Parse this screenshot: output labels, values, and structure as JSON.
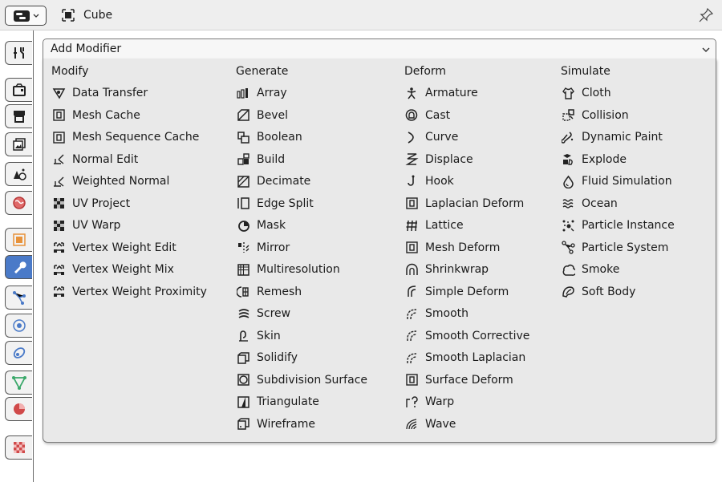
{
  "header": {
    "object_name": "Cube",
    "editor_icon": "properties-editor-icon",
    "pin_icon": "pin-icon"
  },
  "add_modifier": {
    "label": "Add Modifier",
    "chevron": "chevron-down-icon"
  },
  "columns": [
    {
      "title": "Modify",
      "items": [
        {
          "label": "Data Transfer",
          "icon": "data-transfer-icon"
        },
        {
          "label": "Mesh Cache",
          "icon": "mesh-cache-icon"
        },
        {
          "label": "Mesh Sequence Cache",
          "icon": "mesh-sequence-cache-icon"
        },
        {
          "label": "Normal Edit",
          "icon": "normal-edit-icon"
        },
        {
          "label": "Weighted Normal",
          "icon": "weighted-normal-icon"
        },
        {
          "label": "UV Project",
          "icon": "uv-project-icon"
        },
        {
          "label": "UV Warp",
          "icon": "uv-warp-icon"
        },
        {
          "label": "Vertex Weight Edit",
          "icon": "vertex-weight-edit-icon"
        },
        {
          "label": "Vertex Weight Mix",
          "icon": "vertex-weight-mix-icon"
        },
        {
          "label": "Vertex Weight Proximity",
          "icon": "vertex-weight-proximity-icon"
        }
      ]
    },
    {
      "title": "Generate",
      "items": [
        {
          "label": "Array",
          "icon": "array-icon"
        },
        {
          "label": "Bevel",
          "icon": "bevel-icon"
        },
        {
          "label": "Boolean",
          "icon": "boolean-icon"
        },
        {
          "label": "Build",
          "icon": "build-icon"
        },
        {
          "label": "Decimate",
          "icon": "decimate-icon"
        },
        {
          "label": "Edge Split",
          "icon": "edge-split-icon"
        },
        {
          "label": "Mask",
          "icon": "mask-icon"
        },
        {
          "label": "Mirror",
          "icon": "mirror-icon"
        },
        {
          "label": "Multiresolution",
          "icon": "multiresolution-icon"
        },
        {
          "label": "Remesh",
          "icon": "remesh-icon"
        },
        {
          "label": "Screw",
          "icon": "screw-icon"
        },
        {
          "label": "Skin",
          "icon": "skin-icon"
        },
        {
          "label": "Solidify",
          "icon": "solidify-icon"
        },
        {
          "label": "Subdivision Surface",
          "icon": "subdivision-surface-icon"
        },
        {
          "label": "Triangulate",
          "icon": "triangulate-icon"
        },
        {
          "label": "Wireframe",
          "icon": "wireframe-icon"
        }
      ]
    },
    {
      "title": "Deform",
      "items": [
        {
          "label": "Armature",
          "icon": "armature-icon"
        },
        {
          "label": "Cast",
          "icon": "cast-icon"
        },
        {
          "label": "Curve",
          "icon": "curve-icon"
        },
        {
          "label": "Displace",
          "icon": "displace-icon"
        },
        {
          "label": "Hook",
          "icon": "hook-icon"
        },
        {
          "label": "Laplacian Deform",
          "icon": "laplacian-deform-icon"
        },
        {
          "label": "Lattice",
          "icon": "lattice-icon"
        },
        {
          "label": "Mesh Deform",
          "icon": "mesh-deform-icon"
        },
        {
          "label": "Shrinkwrap",
          "icon": "shrinkwrap-icon"
        },
        {
          "label": "Simple Deform",
          "icon": "simple-deform-icon"
        },
        {
          "label": "Smooth",
          "icon": "smooth-icon"
        },
        {
          "label": "Smooth Corrective",
          "icon": "smooth-corrective-icon"
        },
        {
          "label": "Smooth Laplacian",
          "icon": "smooth-laplacian-icon"
        },
        {
          "label": "Surface Deform",
          "icon": "surface-deform-icon"
        },
        {
          "label": "Warp",
          "icon": "warp-icon"
        },
        {
          "label": "Wave",
          "icon": "wave-icon"
        }
      ]
    },
    {
      "title": "Simulate",
      "items": [
        {
          "label": "Cloth",
          "icon": "cloth-icon"
        },
        {
          "label": "Collision",
          "icon": "collision-icon"
        },
        {
          "label": "Dynamic Paint",
          "icon": "dynamic-paint-icon"
        },
        {
          "label": "Explode",
          "icon": "explode-icon"
        },
        {
          "label": "Fluid Simulation",
          "icon": "fluid-simulation-icon"
        },
        {
          "label": "Ocean",
          "icon": "ocean-icon"
        },
        {
          "label": "Particle Instance",
          "icon": "particle-instance-icon"
        },
        {
          "label": "Particle System",
          "icon": "particle-system-icon"
        },
        {
          "label": "Smoke",
          "icon": "smoke-icon"
        },
        {
          "label": "Soft Body",
          "icon": "soft-body-icon"
        }
      ]
    }
  ],
  "tabs": [
    {
      "name": "tool-tab",
      "icon": "tool-icon"
    },
    {
      "name": "render-tab",
      "icon": "render-icon"
    },
    {
      "name": "output-tab",
      "icon": "output-icon"
    },
    {
      "name": "view-layer-tab",
      "icon": "view-layer-icon"
    },
    {
      "name": "scene-tab",
      "icon": "scene-icon"
    },
    {
      "name": "world-tab",
      "icon": "world-icon"
    },
    {
      "name": "object-tab",
      "icon": "object-icon"
    },
    {
      "name": "modifier-tab",
      "icon": "wrench-icon"
    },
    {
      "name": "particles-tab",
      "icon": "particles-icon"
    },
    {
      "name": "physics-tab",
      "icon": "physics-icon"
    },
    {
      "name": "constraints-tab",
      "icon": "constraints-icon"
    },
    {
      "name": "data-tab",
      "icon": "mesh-data-icon"
    },
    {
      "name": "material-tab",
      "icon": "material-icon"
    },
    {
      "name": "texture-tab",
      "icon": "texture-icon"
    }
  ],
  "colors": {
    "accent_blue": "#4a7ac8",
    "object_orange": "#e8923a",
    "data_green": "#3aa86a",
    "material_red": "#d04a4a",
    "menu_bg": "#e9e9e9"
  }
}
